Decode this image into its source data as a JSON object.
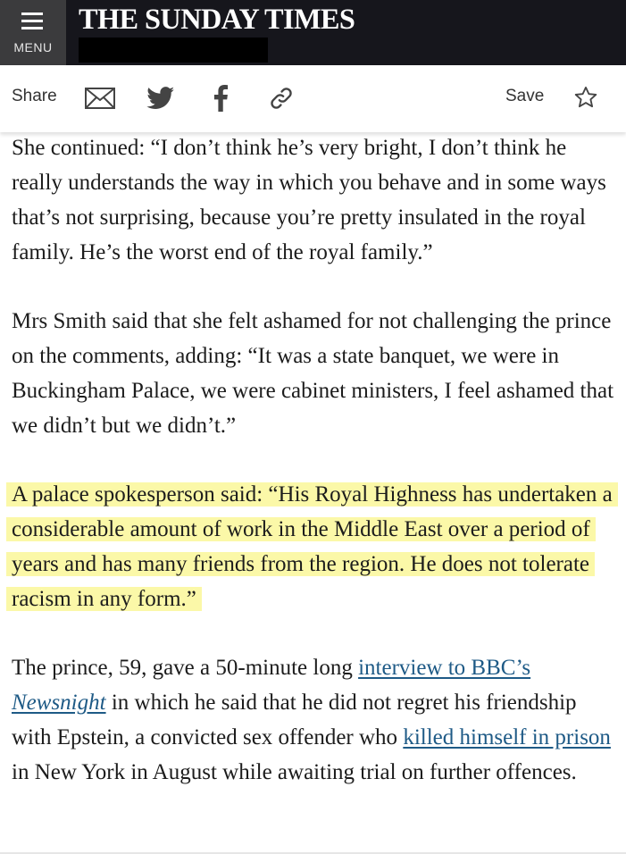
{
  "header": {
    "menu_label": "MENU",
    "masthead": "THE SUNDAY TIMES",
    "background": "#16161c",
    "menu_background": "#3b3b3d"
  },
  "toolbar": {
    "share_label": "Share",
    "icons": [
      "email-icon",
      "twitter-icon",
      "facebook-icon",
      "link-icon",
      "star-icon"
    ],
    "save_label": "Save"
  },
  "article": {
    "p1": "She continued: “I don’t think he’s very bright, I don’t think he really understands the way in which you behave and in some ways that’s not surprising, because you’re pretty insulated in the royal family. He’s the worst end of the royal family.”",
    "p2": "Mrs Smith said that she felt ashamed for not challenging the prince on the comments, adding: “It was a state banquet, we were in Buckingham Palace, we were cabinet ministers, I feel ashamed that we didn’t but we didn’t.”",
    "p3": "A palace spokesperson said: “His Royal Highness has undertaken a considerable amount of work in the Middle East over a period of years and has many friends from the region. He does not tolerate racism in any form.”",
    "p4": {
      "text_a": "The prince, 59, gave a 50-minute long ",
      "link1_a": "interview to BBC’s ",
      "link1_b": "Newsnight",
      "text_b": " in which he said that he did not regret his friendship with Epstein, a convicted sex offender who ",
      "link2": "killed himself in prison",
      "text_c": " in New York in August while awaiting trial on further offences."
    },
    "highlight_color": "#fbf8a8",
    "link_color": "#1e5a86"
  }
}
